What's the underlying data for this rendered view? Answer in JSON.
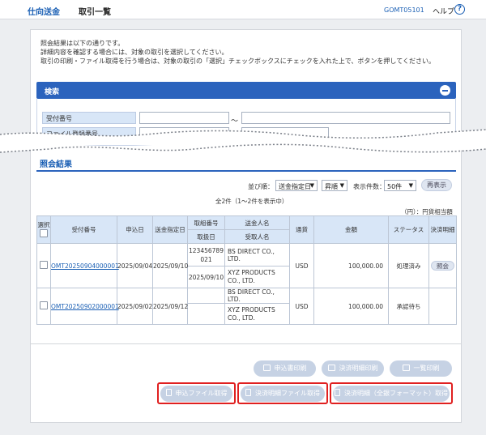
{
  "header": {
    "app_name": "仕向送金",
    "page_title": "取引一覧",
    "screen_code": "GOMT05101",
    "help_label": "ヘルプ",
    "help_icon": "question-circle-icon"
  },
  "intro": {
    "line1": "照会結果は以下の通りです。",
    "line2": "詳細内容を確認する場合には、対象の取引を選択してください。",
    "line3": "取引の印刷・ファイル取得を行う場合は、対象の取引の「選択」チェックボックスにチェックを入れた上で、ボタンを押してください。"
  },
  "search": {
    "title": "検索",
    "field1_label": "受付番号",
    "field2_label": "ファイル登録番号",
    "range_sep": "～"
  },
  "results": {
    "title": "照会結果",
    "sort_label": "並び順：",
    "sort_value": "送金指定日",
    "order_value": "昇順",
    "count_label": "表示件数：",
    "count_value": "50件",
    "redisplay_button": "再表示",
    "summary": "全2件（1～2件を表示中）",
    "unit_note": "（円）：円貨相当額"
  },
  "table": {
    "headers": {
      "select": "選択",
      "reception_no": "受付番号",
      "apply_date": "申込日",
      "remit_date": "送金指定日",
      "detail_no": "取組番号",
      "handle_date": "取扱日",
      "remitter": "送金人名",
      "beneficiary": "受取人名",
      "currency": "通貨",
      "amount": "金額",
      "status": "ステータス",
      "settlement": "決済明細"
    },
    "rows": [
      {
        "reception_no": "OMT20250904000001",
        "apply_date": "2025/09/04",
        "remit_date": "2025/09/10",
        "detail_no": "123456789021",
        "handle_date": "2025/09/10",
        "remitter": "BS DIRECT CO., LTD.",
        "beneficiary": "XYZ PRODUCTS CO., LTD.",
        "currency": "USD",
        "amount": "100,000.00",
        "status": "処理済み",
        "settlement": "照会"
      },
      {
        "reception_no": "OMT20250902000001",
        "apply_date": "2025/09/02",
        "remit_date": "2025/09/12",
        "detail_no": "",
        "handle_date": "",
        "remitter": "BS DIRECT CO., LTD.",
        "beneficiary": "XYZ PRODUCTS CO., LTD.",
        "currency": "USD",
        "amount": "100,000.00",
        "status": "承認待ち",
        "settlement": ""
      }
    ]
  },
  "buttons": {
    "print_application": "申込書印刷",
    "print_settlement": "決済明細印刷",
    "print_list": "一覧印刷",
    "get_application_file": "申込ファイル取得",
    "get_settlement_file": "決済明細ファイル取得",
    "get_settlement_full": "決済明細（全銀フォーマット）取得"
  },
  "colors": {
    "accent": "#2b63bd",
    "highlight": "#e02020",
    "disabled_button": "#c6d2e4"
  }
}
